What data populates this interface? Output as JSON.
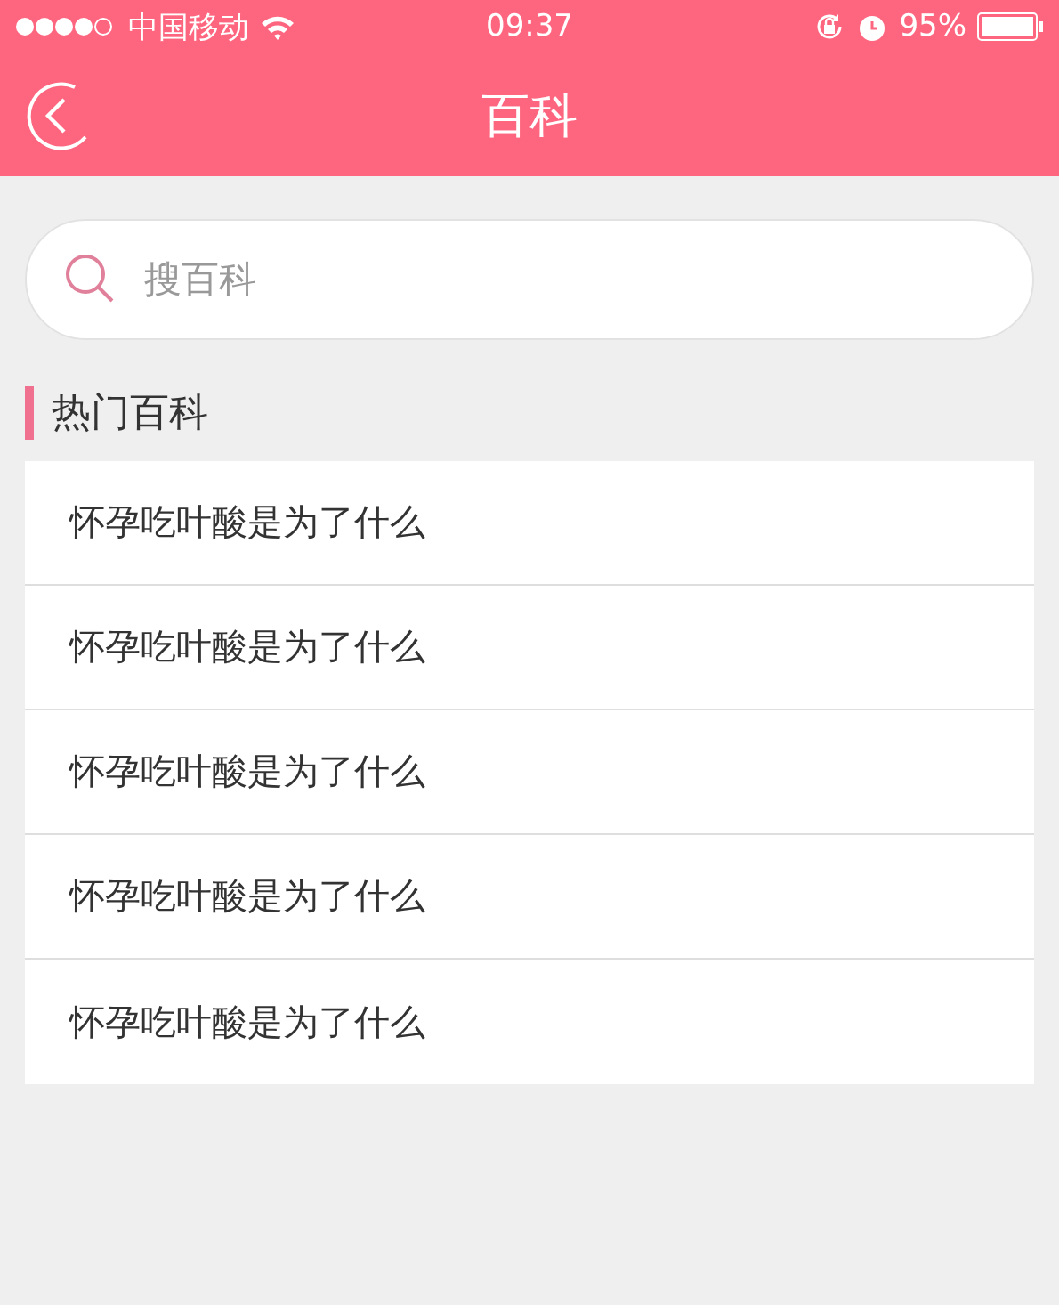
{
  "status_bar": {
    "carrier": "中国移动",
    "time": "09:37",
    "battery": "95%"
  },
  "nav": {
    "title": "百科"
  },
  "search": {
    "placeholder": "搜百科"
  },
  "section": {
    "title": "热门百科"
  },
  "items": [
    {
      "label": "怀孕吃叶酸是为了什么"
    },
    {
      "label": "怀孕吃叶酸是为了什么"
    },
    {
      "label": "怀孕吃叶酸是为了什么"
    },
    {
      "label": "怀孕吃叶酸是为了什么"
    },
    {
      "label": "怀孕吃叶酸是为了什么"
    }
  ]
}
